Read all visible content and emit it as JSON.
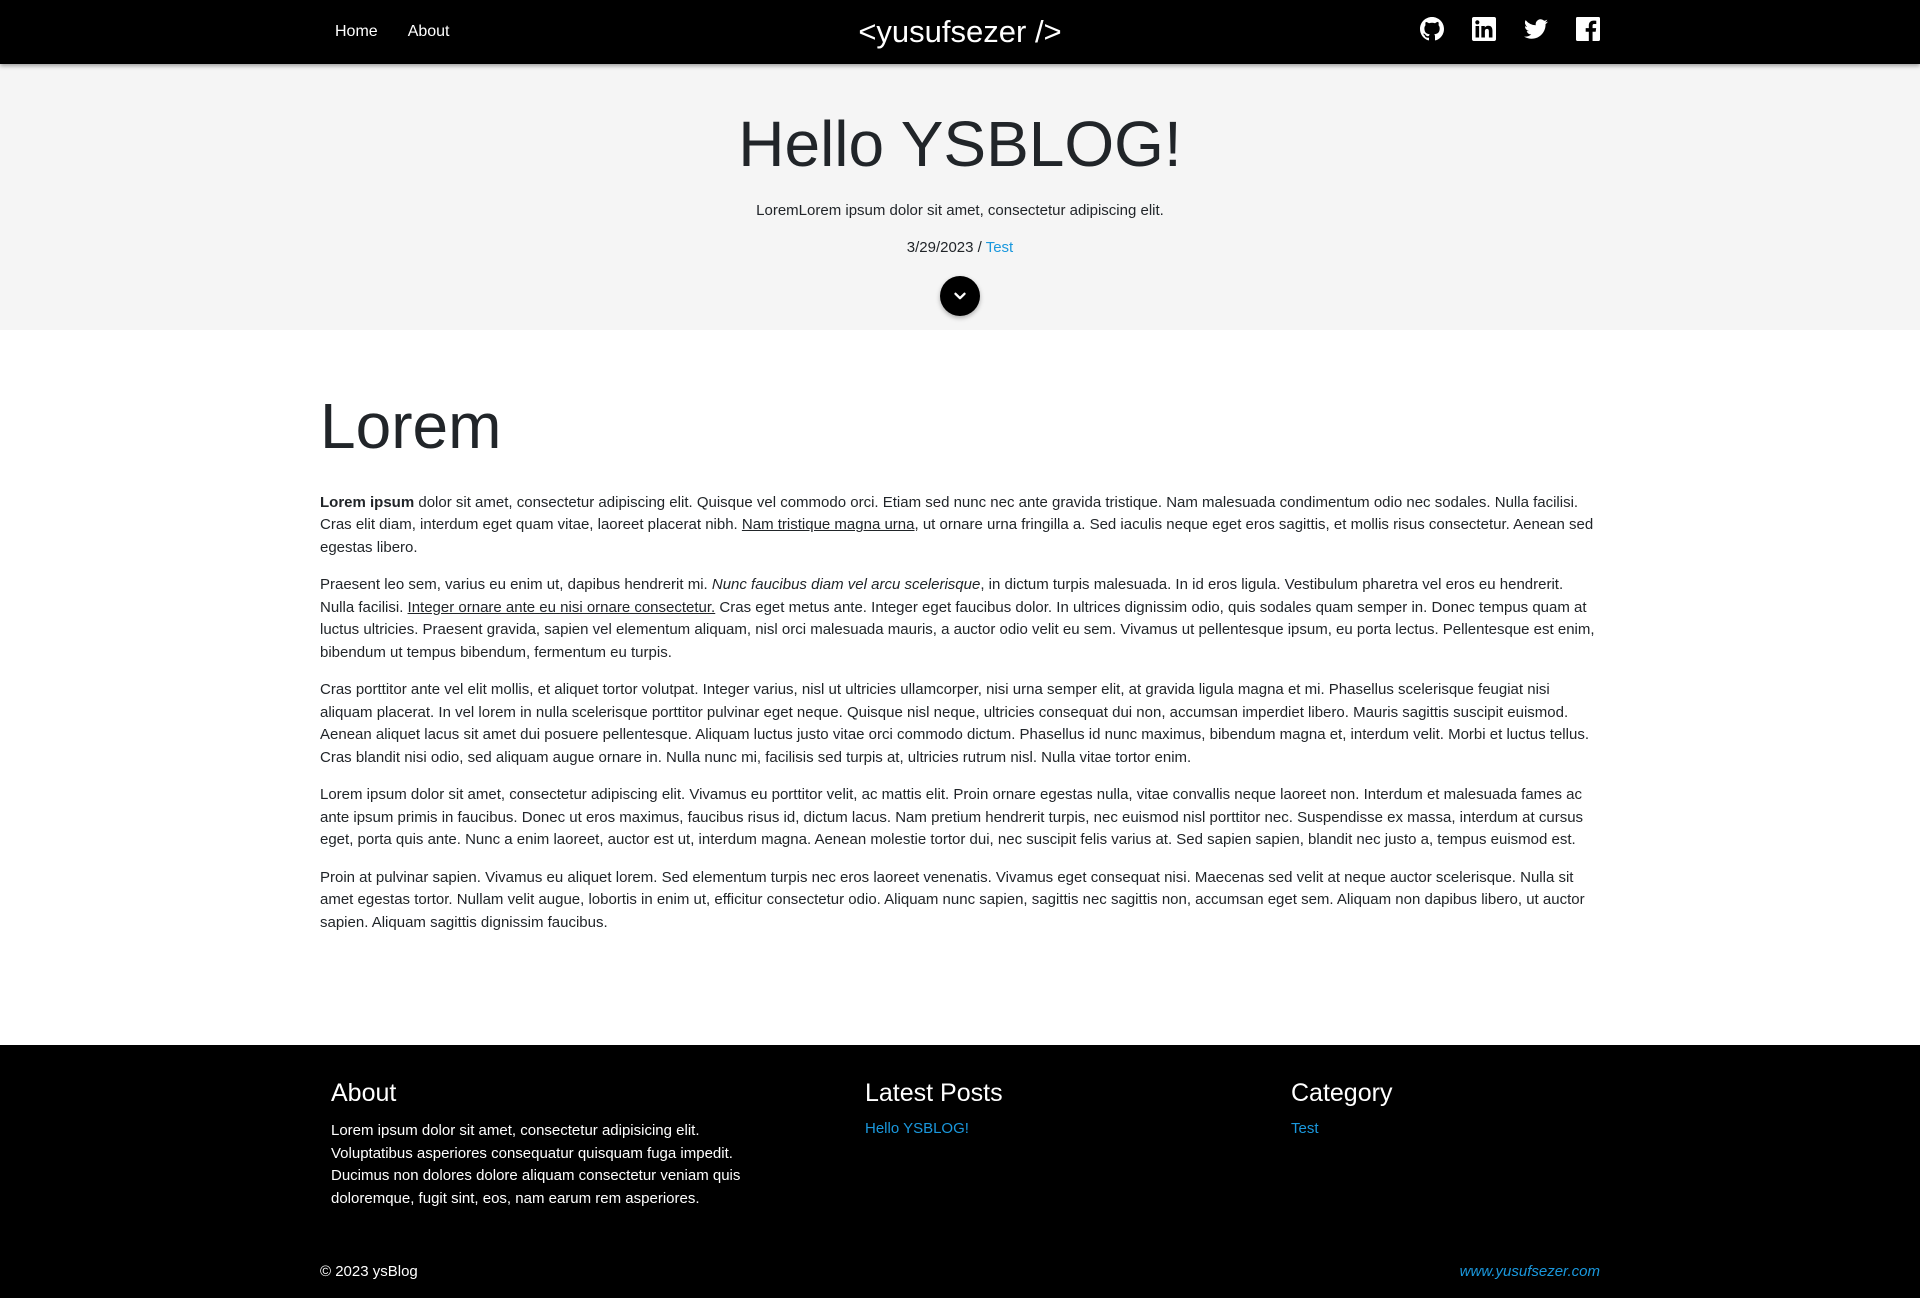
{
  "navbar": {
    "links": [
      {
        "label": "Home"
      },
      {
        "label": "About"
      }
    ],
    "brand": "<yusufsezer />",
    "social_icons": [
      "github-icon",
      "linkedin-icon",
      "twitter-icon",
      "facebook-icon"
    ]
  },
  "hero": {
    "title": "Hello YSBLOG!",
    "subtitle": "LoremLorem ipsum dolor sit amet, consectetur adipiscing elit.",
    "date": "3/29/2023",
    "separator": " / ",
    "category": "Test",
    "scroll_icon": "chevron-down-icon"
  },
  "article": {
    "heading": "Lorem",
    "p1": {
      "bold": "Lorem ipsum",
      "text1": " dolor sit amet, consectetur adipiscing elit. Quisque vel commodo orci. Etiam sed nunc nec ante gravida tristique. Nam malesuada condimentum odio nec sodales. Nulla facilisi. Cras elit diam, interdum eget quam vitae, laoreet placerat nibh. ",
      "link": "Nam tristique magna urna",
      "text2": ", ut ornare urna fringilla a. Sed iaculis neque eget eros sagittis, et mollis risus consectetur. Aenean sed egestas libero."
    },
    "p2": {
      "text1": "Praesent leo sem, varius eu enim ut, dapibus hendrerit mi. ",
      "italic": "Nunc faucibus diam vel arcu scelerisque",
      "text2": ", in dictum turpis malesuada. In id eros ligula. Vestibulum pharetra vel eros eu hendrerit. Nulla facilisi. ",
      "link": "Integer ornare ante eu nisi ornare consectetur.",
      "text3": " Cras eget metus ante. Integer eget faucibus dolor. In ultrices dignissim odio, quis sodales quam semper in. Donec tempus quam at luctus ultricies. Praesent gravida, sapien vel elementum aliquam, nisl orci malesuada mauris, a auctor odio velit eu sem. Vivamus ut pellentesque ipsum, eu porta lectus. Pellentesque est enim, bibendum ut tempus bibendum, fermentum eu turpis."
    },
    "p3": "Cras porttitor ante vel elit mollis, et aliquet tortor volutpat. Integer varius, nisl ut ultricies ullamcorper, nisi urna semper elit, at gravida ligula magna et mi. Phasellus scelerisque feugiat nisi aliquam placerat. In vel lorem in nulla scelerisque porttitor pulvinar eget neque. Quisque nisl neque, ultricies consequat dui non, accumsan imperdiet libero. Mauris sagittis suscipit euismod. Aenean aliquet lacus sit amet dui posuere pellentesque. Aliquam luctus justo vitae orci commodo dictum. Phasellus id nunc maximus, bibendum magna et, interdum velit. Morbi et luctus tellus. Cras blandit nisi odio, sed aliquam augue ornare in. Nulla nunc mi, facilisis sed turpis at, ultricies rutrum nisl. Nulla vitae tortor enim.",
    "p4": "Lorem ipsum dolor sit amet, consectetur adipiscing elit. Vivamus eu porttitor velit, ac mattis elit. Proin ornare egestas nulla, vitae convallis neque laoreet non. Interdum et malesuada fames ac ante ipsum primis in faucibus. Donec ut eros maximus, faucibus risus id, dictum lacus. Nam pretium hendrerit turpis, nec euismod nisl porttitor nec. Suspendisse ex massa, interdum at cursus eget, porta quis ante. Nunc a enim laoreet, auctor est ut, interdum magna. Aenean molestie tortor dui, nec suscipit felis varius at. Sed sapien sapien, blandit nec justo a, tempus euismod est.",
    "p5": "Proin at pulvinar sapien. Vivamus eu aliquet lorem. Sed elementum turpis nec eros laoreet venenatis. Vivamus eget consequat nisi. Maecenas sed velit at neque auctor scelerisque. Nulla sit amet egestas tortor. Nullam velit augue, lobortis in enim ut, efficitur consectetur odio. Aliquam nunc sapien, sagittis nec sagittis non, accumsan eget sem. Aliquam non dapibus libero, ut auctor sapien. Aliquam sagittis dignissim faucibus."
  },
  "footer": {
    "about": {
      "heading": "About",
      "text": "Lorem ipsum dolor sit amet, consectetur adipisicing elit. Voluptatibus asperiores consequatur quisquam fuga impedit. Ducimus non dolores dolore aliquam consectetur veniam quis doloremque, fugit sint, eos, nam earum rem asperiores."
    },
    "latest_posts": {
      "heading": "Latest Posts",
      "items": [
        "Hello YSBLOG!"
      ]
    },
    "category": {
      "heading": "Category",
      "items": [
        "Test"
      ]
    },
    "copyright": "© 2023 ysBlog",
    "site_link": "www.yusufsezer.com"
  },
  "colors": {
    "navbar_bg": "#000000",
    "hero_bg": "#f5f5f5",
    "link_blue": "#1a98dd",
    "text": "#212529"
  }
}
